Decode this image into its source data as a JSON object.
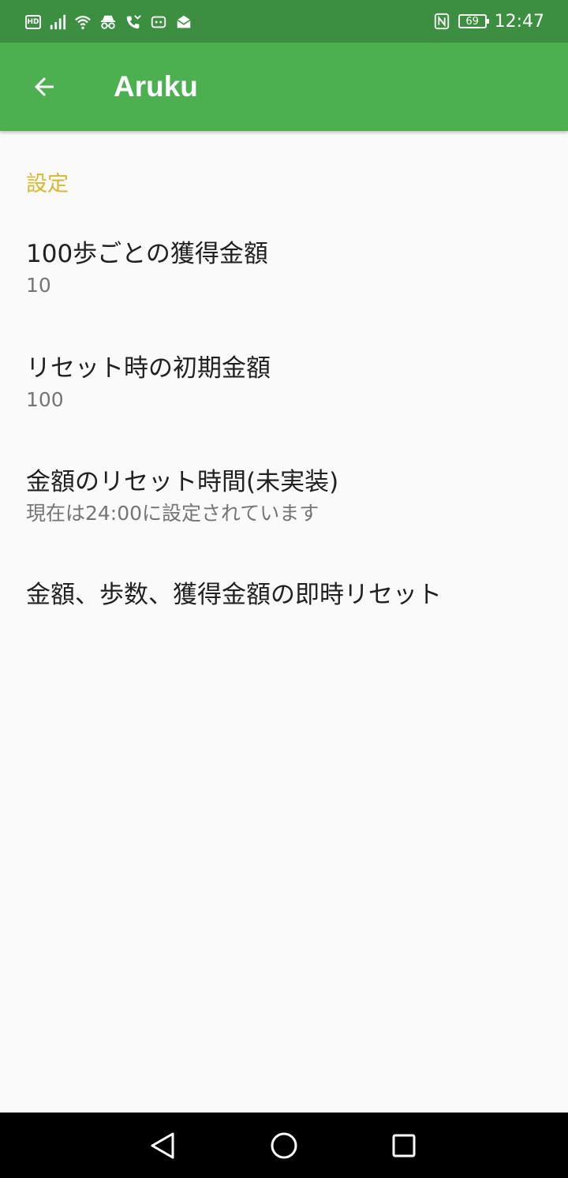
{
  "status_bar": {
    "network_badge": "HD",
    "battery_level": "69",
    "time": "12:47"
  },
  "app_bar": {
    "title": "Aruku"
  },
  "settings": {
    "section_header": "設定",
    "items": [
      {
        "title": "100歩ごとの獲得金額",
        "summary": "10"
      },
      {
        "title": "リセット時の初期金額",
        "summary": "100"
      },
      {
        "title": "金額のリセット時間(未実装)",
        "summary": "現在は24:00に設定されています"
      },
      {
        "title": "金額、歩数、獲得金額の即時リセット"
      }
    ]
  },
  "colors": {
    "status_bar": "#3c8f40",
    "app_bar": "#4caf50",
    "section_header": "#d8b82d",
    "background": "#fafafa"
  }
}
